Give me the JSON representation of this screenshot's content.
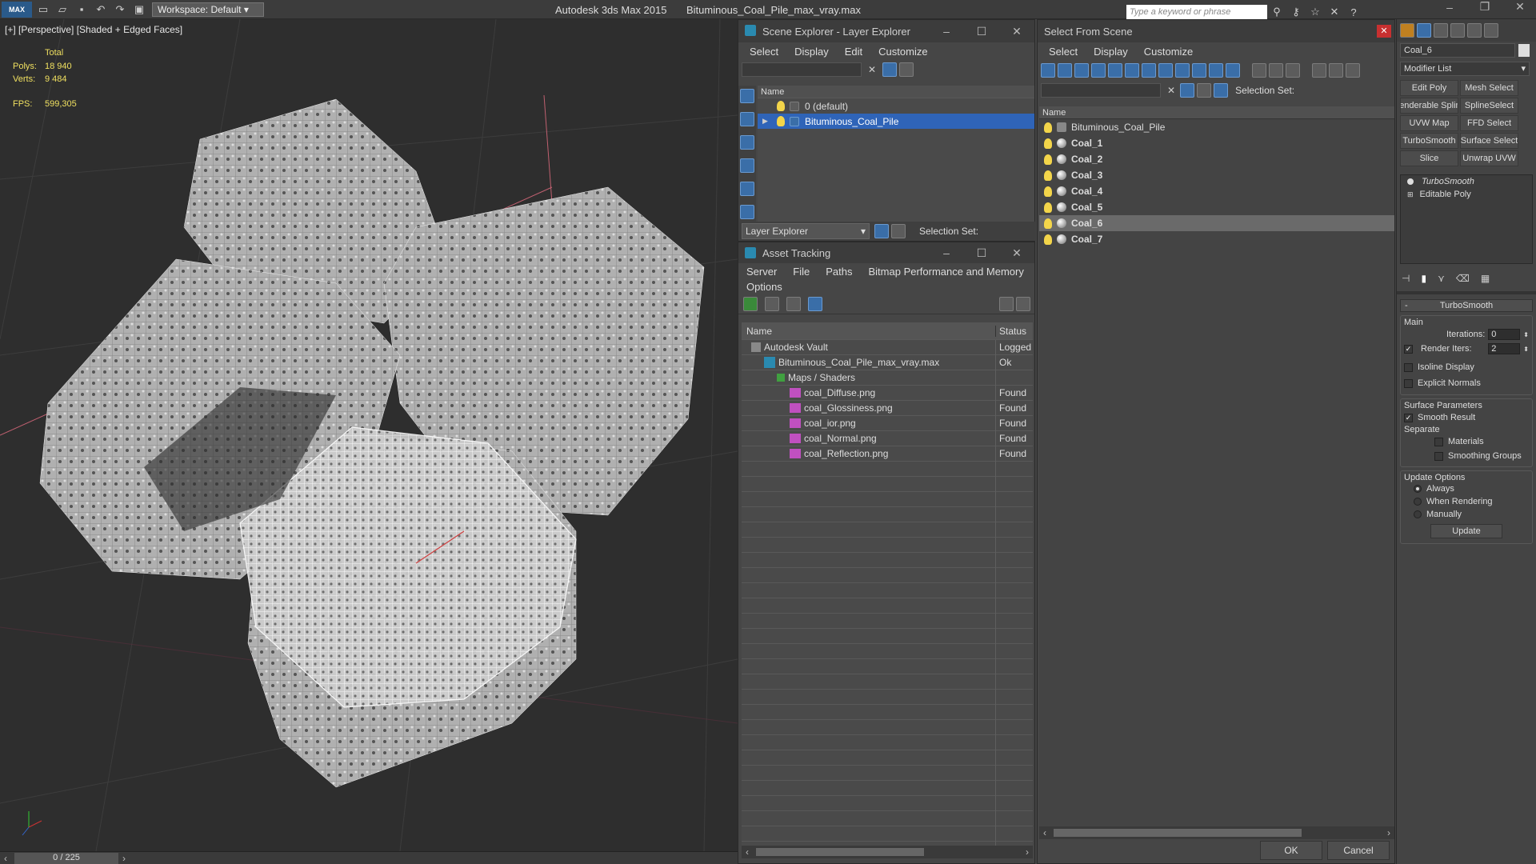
{
  "titlebar": {
    "logo": "MAX",
    "workspace": "Workspace: Default",
    "app_title": "Autodesk 3ds Max  2015",
    "file_title": "Bituminous_Coal_Pile_max_vray.max",
    "search_placeholder": "Type a keyword or phrase",
    "icons": [
      "new-file-icon",
      "open-file-icon",
      "save-icon",
      "undo-icon",
      "redo-icon",
      "project-folder-icon"
    ]
  },
  "viewport": {
    "label": "[+] [Perspective] [Shaded + Edged Faces]",
    "total_label": "Total",
    "polys_label": "Polys:",
    "polys_value": "18 940",
    "verts_label": "Verts:",
    "verts_value": "9 484",
    "fps_label": "FPS:",
    "fps_value": "599,305",
    "timeline": "0 / 225"
  },
  "scene_explorer": {
    "title": "Scene Explorer - Layer Explorer",
    "menu": [
      "Select",
      "Display",
      "Edit",
      "Customize"
    ],
    "col_name": "Name",
    "rows": [
      {
        "label": "0 (default)",
        "selected": false
      },
      {
        "label": "Bituminous_Coal_Pile",
        "selected": true
      }
    ],
    "footer_dropdown": "Layer Explorer",
    "selection_set": "Selection Set:"
  },
  "asset_tracking": {
    "title": "Asset Tracking",
    "menu": [
      "Server",
      "File",
      "Paths",
      "Bitmap Performance and Memory"
    ],
    "menu2": "Options",
    "col_name": "Name",
    "col_status": "Status",
    "rows": [
      {
        "name": "Autodesk Vault",
        "status": "Logged",
        "indent": 0
      },
      {
        "name": "Bituminous_Coal_Pile_max_vray.max",
        "status": "Ok",
        "indent": 1
      },
      {
        "name": "Maps / Shaders",
        "status": "",
        "indent": 2
      },
      {
        "name": "coal_Diffuse.png",
        "status": "Found",
        "indent": 3
      },
      {
        "name": "coal_Glossiness.png",
        "status": "Found",
        "indent": 3
      },
      {
        "name": "coal_ior.png",
        "status": "Found",
        "indent": 3
      },
      {
        "name": "coal_Normal.png",
        "status": "Found",
        "indent": 3
      },
      {
        "name": "coal_Reflection.png",
        "status": "Found",
        "indent": 3
      }
    ]
  },
  "select_from_scene": {
    "title": "Select From Scene",
    "menu": [
      "Select",
      "Display",
      "Customize"
    ],
    "selection_set": "Selection Set:",
    "col_name": "Name",
    "rows": [
      {
        "label": "Bituminous_Coal_Pile",
        "bold": false,
        "selected": false
      },
      {
        "label": "Coal_1",
        "bold": true,
        "selected": false
      },
      {
        "label": "Coal_2",
        "bold": true,
        "selected": false
      },
      {
        "label": "Coal_3",
        "bold": true,
        "selected": false
      },
      {
        "label": "Coal_4",
        "bold": true,
        "selected": false
      },
      {
        "label": "Coal_5",
        "bold": true,
        "selected": false
      },
      {
        "label": "Coal_6",
        "bold": true,
        "selected": true
      },
      {
        "label": "Coal_7",
        "bold": true,
        "selected": false
      }
    ],
    "ok": "OK",
    "cancel": "Cancel"
  },
  "command_panel": {
    "object_name": "Coal_6",
    "modifier_list": "Modifier List",
    "buttons": [
      [
        "Edit Poly",
        "Mesh Select"
      ],
      [
        "Renderable Spline",
        "SplineSelect"
      ],
      [
        "UVW Map",
        "FFD Select"
      ],
      [
        "TurboSmooth",
        "Surface Select"
      ],
      [
        "Slice",
        "Unwrap UVW"
      ]
    ],
    "stack": [
      "TurboSmooth",
      "Editable Poly"
    ],
    "rollout_title": "TurboSmooth",
    "main": "Main",
    "iterations_label": "Iterations:",
    "iterations": "0",
    "render_iters_label": "Render Iters:",
    "render_iters": "2",
    "isoline": "Isoline Display",
    "explicit": "Explicit Normals",
    "surface_params": "Surface Parameters",
    "smooth_result": "Smooth Result",
    "separate": "Separate",
    "materials": "Materials",
    "smoothing_groups": "Smoothing Groups",
    "update_options": "Update Options",
    "always": "Always",
    "when_rendering": "When Rendering",
    "manually": "Manually",
    "update": "Update"
  }
}
